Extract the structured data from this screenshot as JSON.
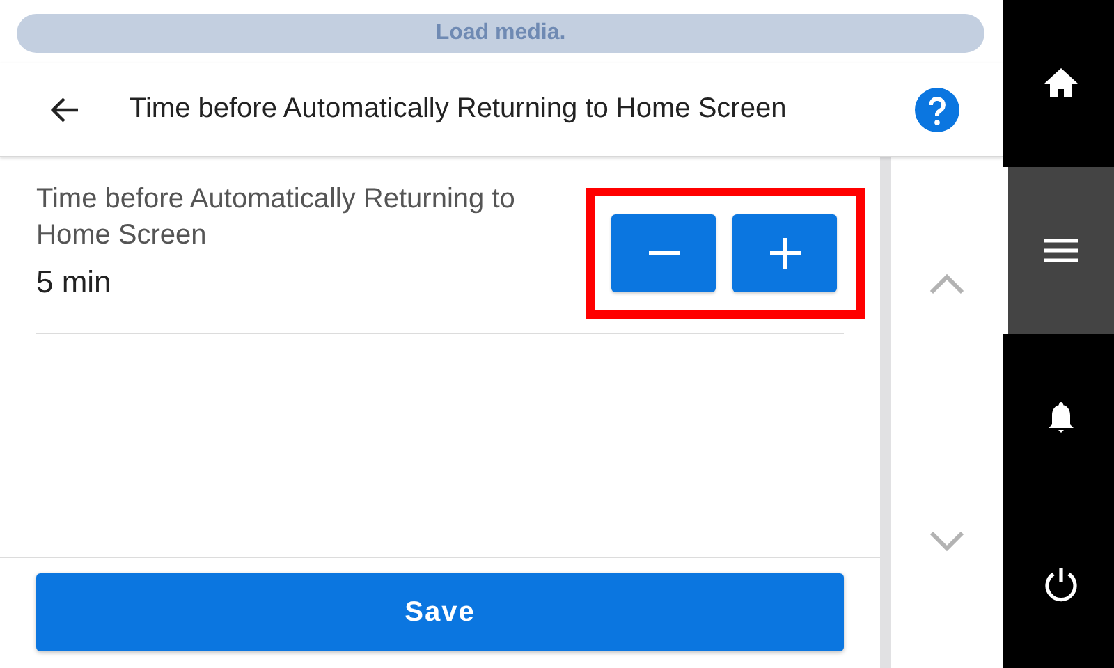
{
  "status_banner": {
    "text": "Load media."
  },
  "header": {
    "title": "Time before Automatically Returning to Home Screen"
  },
  "setting": {
    "label": "Time before Automatically Returning to Home Screen",
    "value": "5 min",
    "highlighted": true
  },
  "save_button": {
    "label": "Save"
  },
  "nav": [
    {
      "kind": "home",
      "selected": false
    },
    {
      "kind": "menu",
      "selected": true
    },
    {
      "kind": "notifications",
      "selected": false
    },
    {
      "kind": "power",
      "selected": false
    }
  ]
}
